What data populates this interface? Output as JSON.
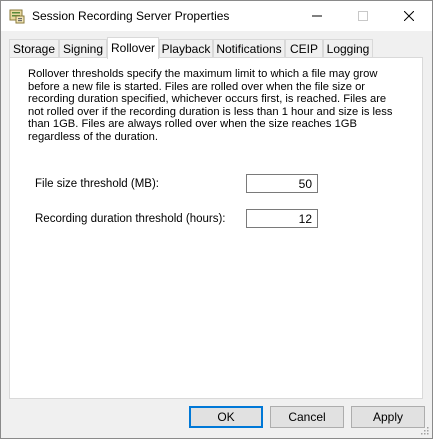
{
  "window": {
    "title": "Session Recording Server Properties"
  },
  "tabs": [
    {
      "label": "Storage"
    },
    {
      "label": "Signing"
    },
    {
      "label": "Rollover"
    },
    {
      "label": "Playback"
    },
    {
      "label": "Notifications"
    },
    {
      "label": "CEIP"
    },
    {
      "label": "Logging"
    }
  ],
  "active_tab": "Rollover",
  "rollover": {
    "description": "Rollover thresholds specify the maximum limit to which a file may grow before a new file is started. Files are rolled over when the file size or recording duration specified, whichever occurs first, is reached. Files are not rolled over if the recording duration is less than 1 hour and size is less than 1GB. Files are always rolled over when the size reaches 1GB regardless of the duration.",
    "file_size_label": "File size threshold (MB):",
    "file_size_value": "50",
    "duration_label": "Recording duration threshold (hours):",
    "duration_value": "12"
  },
  "buttons": {
    "ok": "OK",
    "cancel": "Cancel",
    "apply": "Apply"
  },
  "icons": {
    "app": "server-properties-icon",
    "minimize": "minimize-icon",
    "maximize": "maximize-icon",
    "close": "close-icon"
  }
}
